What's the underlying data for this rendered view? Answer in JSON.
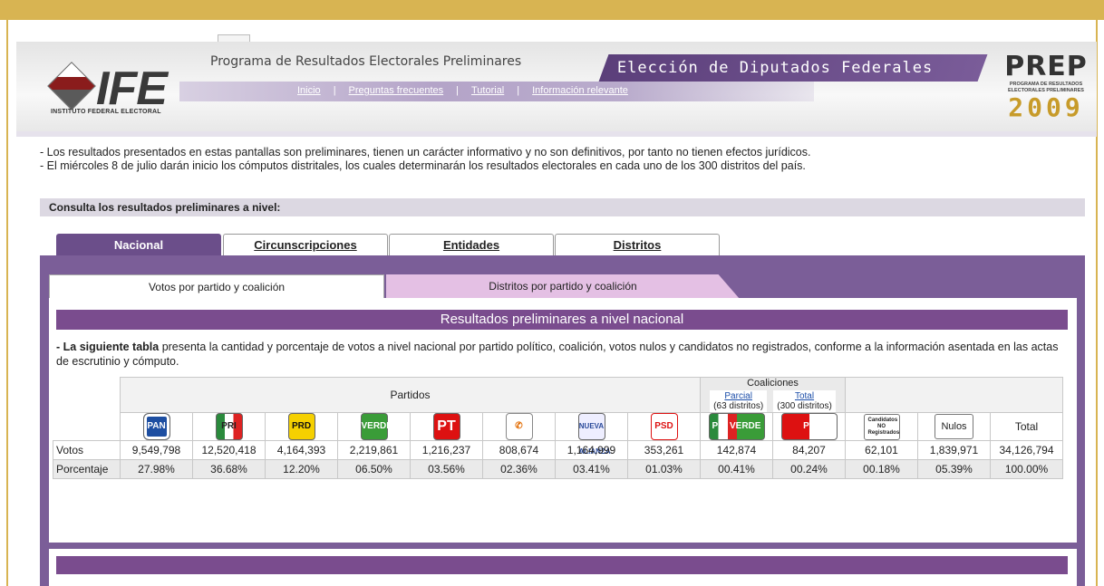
{
  "header": {
    "org_logo": "IFE",
    "org_name": "INSTITUTO FEDERAL ELECTORAL",
    "program_title": "Programa de Resultados Electorales Preliminares",
    "election_title": "Elección de Diputados Federales",
    "prep_logo": "PREP",
    "prep_sub": "PROGRAMA DE RESULTADOS ELECTORALES PRELIMINARES",
    "prep_year": "2009",
    "nav": [
      "Inicio",
      "Preguntas frecuentes",
      "Tutorial",
      "Información relevante"
    ]
  },
  "notices": [
    "- Los resultados presentados en estas pantallas son preliminares, tienen un carácter informativo y no son definitivos, por tanto no tienen efectos jurídicos.",
    "- El miércoles 8 de julio darán inicio los cómputos distritales, los cuales determinarán los resultados electorales en cada uno de los 300 distritos del país."
  ],
  "consulta_label": "Consulta los resultados preliminares a nivel:",
  "main_tabs": [
    "Nacional",
    "Circunscripciones",
    "Entidades",
    "Distritos"
  ],
  "sub_tabs": [
    "Votos por partido y coalición",
    "Distritos por partido y coalición"
  ],
  "results_title": "Resultados preliminares a nivel nacional",
  "description_bold": "- La siguiente tabla",
  "description_rest": " presenta la cantidad y porcentaje de votos a nivel nacional por partido político, coalición, votos nulos y candidatos no registrados, conforme a la información asentada en las actas de escrutinio y cómputo.",
  "table": {
    "partidos_label": "Partidos",
    "coaliciones_label": "Coaliciones",
    "parcial_label": "Parcial",
    "parcial_sub": "(63 distritos)",
    "total_coal_label": "Total",
    "total_coal_sub": "(300 distritos)",
    "logos": {
      "pan": "PAN",
      "pri": "PRI",
      "prd": "PRD",
      "verde": "VERDE",
      "pt": "PT",
      "conv": "✆",
      "na": "NUEVA ALIANZA",
      "psd": "PSD",
      "pri_verde": "PRI VERDE",
      "pt_conv": "PT"
    },
    "no_reg_label": "Candidatos NO Registrados",
    "nulos_label": "Nulos",
    "total_label": "Total",
    "votos_label": "Votos",
    "porcentaje_label": "Porcentaje",
    "votos": [
      "9,549,798",
      "12,520,418",
      "4,164,393",
      "2,219,861",
      "1,216,237",
      "808,674",
      "1,164,999",
      "353,261",
      "142,874",
      "84,207",
      "62,101",
      "1,839,971",
      "34,126,794"
    ],
    "porcentaje": [
      "27.98%",
      "36.68%",
      "12.20%",
      "06.50%",
      "03.56%",
      "02.36%",
      "03.41%",
      "01.03%",
      "00.41%",
      "00.24%",
      "00.18%",
      "05.39%",
      "100.00%"
    ]
  }
}
